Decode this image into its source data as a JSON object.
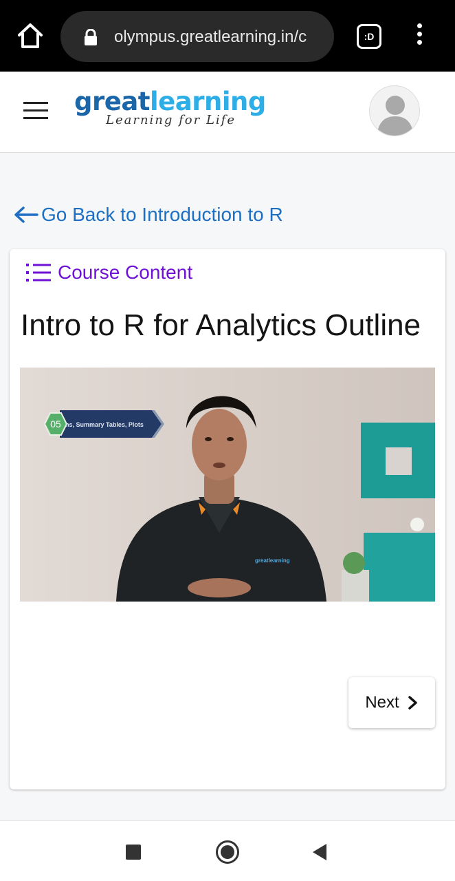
{
  "browser": {
    "url": "olympus.greatlearning.in/c",
    "tabs_label": ":D"
  },
  "header": {
    "logo_part1": "great",
    "logo_part2": "learning",
    "logo_tagline": "Learning for Life"
  },
  "page": {
    "back_link": "Go Back to Introduction to R",
    "course_content": "Course Content",
    "title": "Intro to R for Analytics Outline",
    "video_badge_number": "05",
    "video_badge_text": "ns, Summary Tables, Plots",
    "shirt_logo": "greatlearning",
    "next_button": "Next"
  },
  "colors": {
    "link_blue": "#1c6fc2",
    "course_purple": "#6f12d6",
    "logo_dark_blue": "#1a66a8",
    "logo_light_blue": "#2eaee6"
  }
}
